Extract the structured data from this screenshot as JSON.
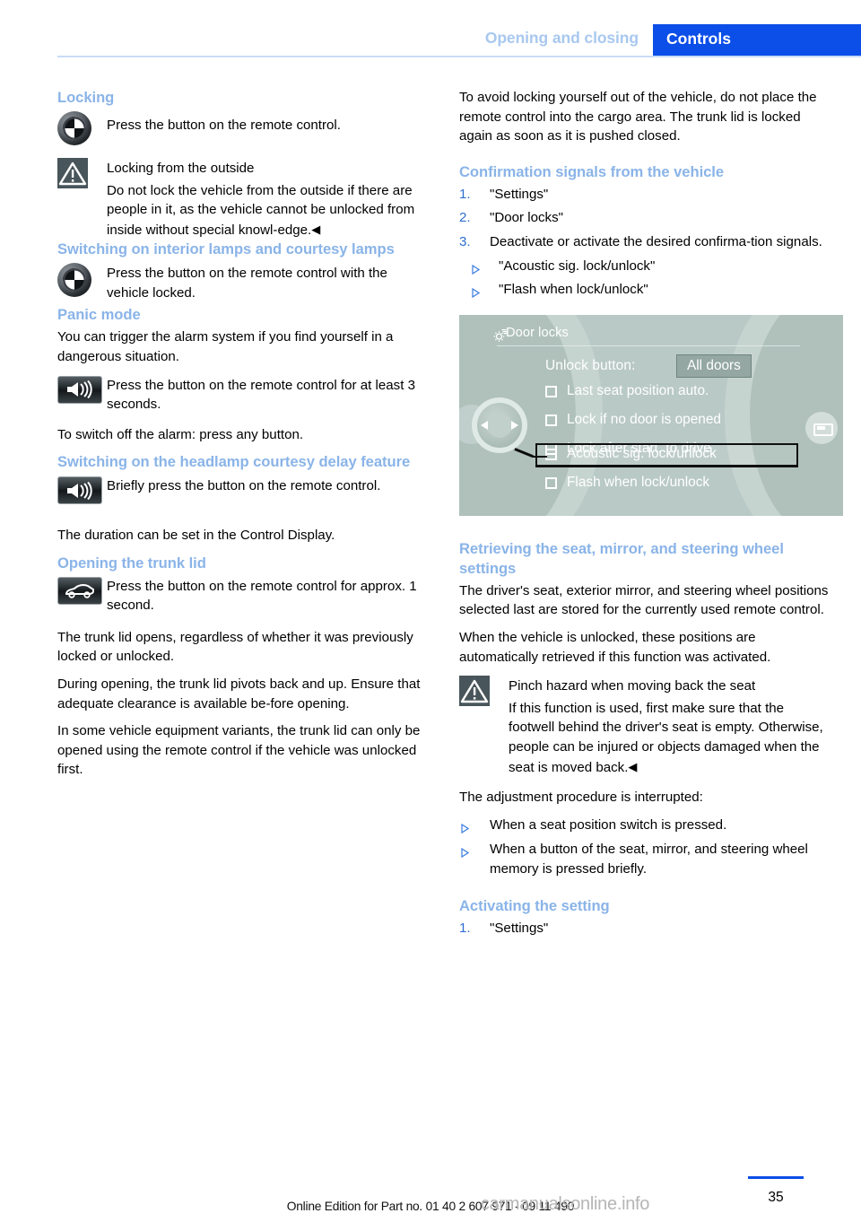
{
  "header": {
    "chapter": "Opening and closing",
    "section": "Controls"
  },
  "left_column": {
    "locking": {
      "heading": "Locking",
      "bmw_line": "Press the button on the remote control.",
      "warning_title": "Locking from the outside",
      "warning_body": "Do not lock the vehicle from the outside if there are people in it, as the vehicle cannot be unlocked from inside without special knowl-edge.",
      "warning_endmark": "◀"
    },
    "interior_lamps": {
      "heading": "Switching on interior lamps and courtesy lamps",
      "bmw_line": "Press the button on the remote control with the vehicle locked."
    },
    "panic_mode": {
      "heading": "Panic mode",
      "intro": "You can trigger the alarm system if you find yourself in a dangerous situation.",
      "button_line": "Press the button on the remote control for at least 3 seconds.",
      "outro": "To switch off the alarm: press any button."
    },
    "headlamp_courtesy": {
      "heading": "Switching on the headlamp courtesy delay feature",
      "button_line": "Briefly press the button on the remote control.",
      "outro": "The duration can be set in the Control Display."
    },
    "trunk_lid": {
      "heading": "Opening the trunk lid",
      "button_line": "Press the button on the remote control for approx. 1 second.",
      "para1": "The trunk lid opens, regardless of whether it was previously locked or unlocked.",
      "para2": "During opening, the trunk lid pivots back and up. Ensure that adequate clearance is available be-fore opening.",
      "para3": "In some vehicle equipment variants, the trunk lid can only be opened using the remote control if the vehicle was unlocked first."
    }
  },
  "right_column": {
    "cargo_para": "To avoid locking yourself out of the vehicle, do not place the remote control into the cargo area. The trunk lid is locked again as soon as it is pushed closed.",
    "confirmation": {
      "heading": "Confirmation signals from the vehicle",
      "steps": [
        {
          "num": "1.",
          "text": "\"Settings\""
        },
        {
          "num": "2.",
          "text": "\"Door locks\""
        },
        {
          "num": "3.",
          "text": "Deactivate or activate the desired confirma-tion signals."
        }
      ],
      "substeps": [
        "\"Acoustic sig. lock/unlock\"",
        "\"Flash when lock/unlock\""
      ]
    },
    "control_display": {
      "title": "Door locks",
      "unlock_label": "Unlock button:",
      "unlock_value": "All doors",
      "options": [
        "Last seat position auto.",
        "Lock if no door is opened",
        "Lock after start. to drive",
        "Acoustic sig. lock/unlock",
        "Flash when lock/unlock"
      ],
      "highlighted_index": 3
    },
    "retrieving": {
      "heading": "Retrieving the seat, mirror, and steering wheel settings",
      "para1": "The driver's seat, exterior mirror, and steering wheel positions selected last are stored for the currently used remote control.",
      "para2": "When the vehicle is unlocked, these positions are automatically retrieved if this function was activated.",
      "warning_title": "Pinch hazard when moving back the seat",
      "warning_body": "If this function is used, first make sure that the footwell behind the driver's seat is empty. Otherwise, people can be injured or objects damaged when the seat is moved back.",
      "warning_endmark": "◀",
      "interrupt_intro": "The adjustment procedure is interrupted:",
      "interrupt_items": [
        "When a seat position switch is pressed.",
        "When a button of the seat, mirror, and steering wheel memory is pressed briefly."
      ]
    },
    "activating": {
      "heading": "Activating the setting",
      "steps": [
        {
          "num": "1.",
          "text": "\"Settings\""
        }
      ]
    }
  },
  "footer": {
    "edition_text": "Online Edition for Part no. 01 40 2 607 971 - 09 11 490",
    "watermark": "carmanualsonline.info",
    "page_number": "35"
  },
  "colors": {
    "accent_blue": "#0b4ee8",
    "heading_blue": "#8ab4e8",
    "header_chapter_blue": "#a8c8f0",
    "display_bg": "#b9c9c5"
  }
}
